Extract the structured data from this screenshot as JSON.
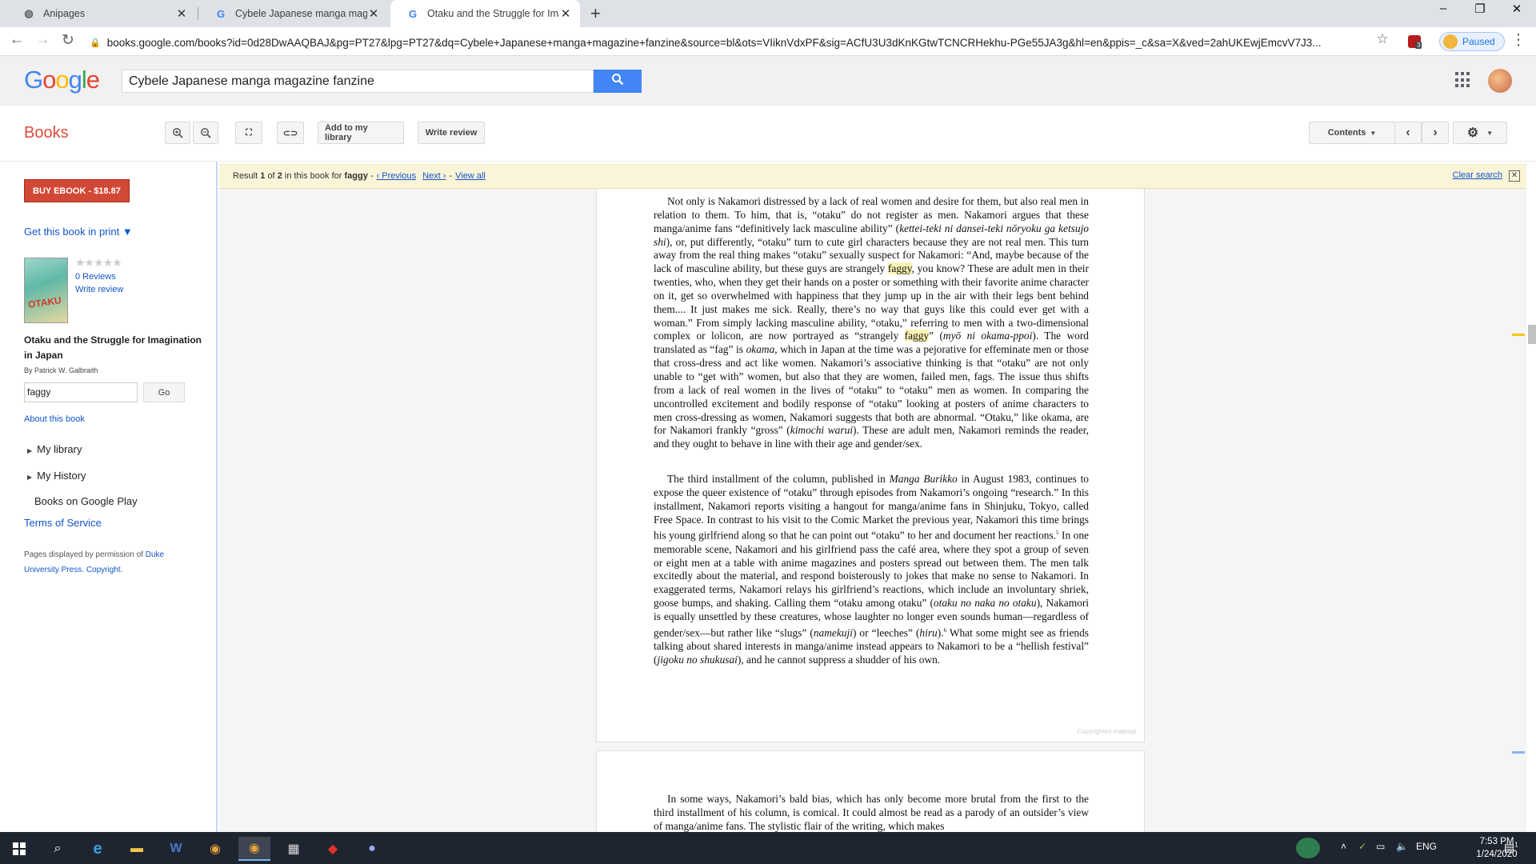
{
  "browser": {
    "tabs": [
      {
        "title": "Anipages"
      },
      {
        "title": "Cybele Japanese manga magazin"
      },
      {
        "title": "Otaku and the Struggle for Imag"
      }
    ],
    "url": "books.google.com/books?id=0d28DwAAQBAJ&pg=PT27&lpg=PT27&dq=Cybele+Japanese+manga+magazine+fanzine&source=bl&ots=VIiknVdxPF&sig=ACfU3U3dKnKGtwTCNCRHekhu-PGe55JA3g&hl=en&ppis=_c&sa=X&ved=2ahUKEwjEmcvV7J3...",
    "profile_status": "Paused",
    "extension_badge": "3"
  },
  "google": {
    "logo": "Google",
    "search_value": "Cybele Japanese manga magazine fanzine"
  },
  "books_toolbar": {
    "title": "Books",
    "add_library": "Add to my library",
    "write_review": "Write review",
    "contents": "Contents"
  },
  "result_bar": {
    "result_label": "Result",
    "current": "1",
    "of_label": "of",
    "total": "2",
    "in_book_label": "in this book for",
    "term": "faggy",
    "previous": "‹ Previous",
    "next": "Next ›",
    "view_all": "View all",
    "clear_search": "Clear search"
  },
  "sidebar": {
    "buy_button": "BUY EBOOK - $18.87",
    "get_print": "Get this book in print ▼",
    "cover_text": "OTAKU",
    "reviews": "0 Reviews",
    "write_review": "Write review",
    "book_title": "Otaku and the Struggle for Imagination in Japan",
    "author": "By Patrick W. Galbraith",
    "search_in_book": "faggy",
    "go": "Go",
    "about": "About this book",
    "my_library": "My library",
    "my_history": "My History",
    "play": "Books on Google Play",
    "tos": "Terms of Service",
    "permission_pre": "Pages displayed by permission of",
    "publisher": "Duke University Press",
    "copyright": "Copyright"
  },
  "page1": {
    "p1_a": "Not only is Nakamori distressed by a lack of real women and desire for them, but also real men in relation to them. To him, that is, “otaku” do not register as men. Nakamori argues that these manga/anime fans “definitively lack masculine ability” (",
    "p1_i1": "kettei-teki ni dansei-teki nōryoku ga ketsujo shi",
    "p1_b": "), or, put differently, “otaku” turn to cute girl characters because they are not real men. This turn away from the real thing makes “otaku” sexually suspect for Nakamori: “And, maybe because of the lack of masculine ability, but these guys are strangely ",
    "p1_hl1": "faggy",
    "p1_c": ", you know? These are adult men in their twenties, who, when they get their hands on a poster or something with their favorite anime character on it, get so overwhelmed with happiness that they jump up in the air with their legs bent behind them.... It just makes me sick. Really, there’s no way that guys like this could ever get with a woman.” From simply lacking masculine ability, “otaku,” referring to men with a two-dimensional complex or lolicon, are now portrayed as “strangely ",
    "p1_hl2": "faggy",
    "p1_d": "” (",
    "p1_i2": "myō ni okama-ppoi",
    "p1_e": "). The word translated as “fag” is ",
    "p1_i3": "okama",
    "p1_f": ", which in Japan at the time was a pejorative for effeminate men or those that cross-dress and act like women. Nakamori’s associative thinking is that “otaku” are not only unable to “get with” women, but also that they are women, failed men, fags. The issue thus shifts from a lack of real women in the lives of “otaku” to “otaku” men as women. In comparing the uncontrolled excitement and bodily response of “otaku” looking at posters of anime characters to men cross-dressing as women, Nakamori suggests that both are abnormal. “Otaku,” like okama, are for Nakamori frankly “gross” (",
    "p1_i4": "kimochi warui",
    "p1_g": "). These are adult men, Nakamori reminds the reader, and they ought to behave in line with their age and gender/sex.",
    "p2_a": "The third installment of the column, published in ",
    "p2_i1": "Manga Burikko",
    "p2_b": " in August 1983, continues to expose the queer existence of “otaku” through episodes from Nakamori’s ongoing “research.” In this installment, Nakamori reports visiting a hangout for manga/anime fans in Shinjuku, Tokyo, called Free Space. In contrast to his visit to the Comic Market the previous year, Nakamori this time brings his young girlfriend along so that he can point out “otaku” to her and document her reactions.",
    "p2_sup1": "5",
    "p2_c": " In one memorable scene, Nakamori and his girlfriend pass the café area, where they spot a group of seven or eight men at a table with anime magazines and posters spread out between them. The men talk excitedly about the material, and respond boisterously to jokes that make no sense to Nakamori. In exaggerated terms, Nakamori relays his girlfriend’s reactions, which include an involuntary shriek, goose bumps, and shaking. Calling them “otaku among otaku” (",
    "p2_i2": "otaku no naka no otaku",
    "p2_d": "), Nakamori is equally unsettled by these creatures, whose laughter no longer even sounds human—regardless of gender/sex—but rather like “slugs” (",
    "p2_i3": "namekuji",
    "p2_e": ") or “leeches” (",
    "p2_i4": "hiru",
    "p2_f": ").",
    "p2_sup2": "6",
    "p2_g": " What some might see as friends talking about shared interests in manga/anime instead appears to Nakamori to be a “hellish festival” (",
    "p2_i5": "jigoku no shukusai",
    "p2_h": "), and he cannot suppress a shudder of his own.",
    "copyright_mark": "Copyrighted material"
  },
  "page2": {
    "p1": "In some ways, Nakamori’s bald bias, which has only become more brutal from the first to the third installment of his column, is comical. It could almost be read as a parody of an outsider’s view of manga/anime fans. The stylistic flair of the writing, which makes"
  },
  "taskbar": {
    "language": "ENG",
    "time": "7:53 PM",
    "date": "1/24/2020",
    "notifications": "1"
  }
}
